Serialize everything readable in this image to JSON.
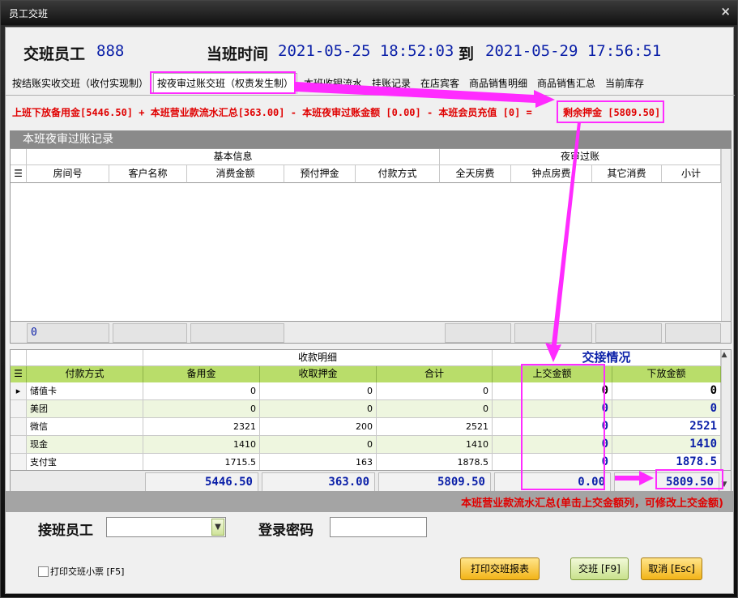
{
  "window": {
    "title": "员工交班",
    "close": "×"
  },
  "header": {
    "staff_label": "交班员工",
    "staff_value": "888",
    "shift_label": "当班时间",
    "start": "2021-05-25 18:52:03",
    "to": "到",
    "end": "2021-05-29 17:56:51"
  },
  "tabs": [
    {
      "label": "按结账实收交班（收付实现制）"
    },
    {
      "label": "按夜审过账交班（权责发生制）"
    },
    {
      "label": "本班收银流水"
    },
    {
      "label": "挂账记录"
    },
    {
      "label": "在店宾客"
    },
    {
      "label": "商品销售明细"
    },
    {
      "label": "商品销售汇总"
    },
    {
      "label": "当前库存"
    }
  ],
  "formula": {
    "text": "上班下放备用金[5446.50] + 本班营业款流水汇总[363.00] - 本班夜审过账金额 [0.00] - 本班会员充值 [0]  =",
    "remaining": "剩余押金 [5809.50]"
  },
  "night_audit": {
    "title": "本班夜审过账记录",
    "group_basic": "基本信息",
    "group_audit": "夜审过账",
    "columns": [
      "房间号",
      "客户名称",
      "消费金额",
      "预付押金",
      "付款方式",
      "全天房费",
      "钟点房费",
      "其它消费",
      "小计"
    ],
    "footer_count": "0"
  },
  "payments": {
    "group_detail": "收款明细",
    "group_handover": "交接情况",
    "columns": [
      "付款方式",
      "备用金",
      "收取押金",
      "合计",
      "上交金额",
      "下放金额"
    ],
    "rows": [
      {
        "method": "储值卡",
        "reserve": "0",
        "deposit": "0",
        "total": "0",
        "submit": "0",
        "release": "0"
      },
      {
        "method": "美团",
        "reserve": "0",
        "deposit": "0",
        "total": "0",
        "submit": "0",
        "release": "0"
      },
      {
        "method": "微信",
        "reserve": "2321",
        "deposit": "200",
        "total": "2521",
        "submit": "0",
        "release": "2521"
      },
      {
        "method": "现金",
        "reserve": "1410",
        "deposit": "0",
        "total": "1410",
        "submit": "0",
        "release": "1410"
      },
      {
        "method": "支付宝",
        "reserve": "1715.5",
        "deposit": "163",
        "total": "1878.5",
        "submit": "0",
        "release": "1878.5"
      }
    ],
    "totals": {
      "reserve": "5446.50",
      "deposit": "363.00",
      "total": "5809.50",
      "submit": "0.00",
      "release": "5809.50"
    }
  },
  "summary_note": "本班营业款流水汇总(单击上交金额列，可修改上交金额)",
  "bottom": {
    "receiver_label": "接班员工",
    "password_label": "登录密码",
    "print_ticket": "打印交班小票 [F5]",
    "print_report": "打印交班报表",
    "handover": "交班 [F9]",
    "cancel": "取消 [Esc]"
  },
  "colors": {
    "accent_blue": "#0a1fa8",
    "alert_red": "#e00000",
    "highlight_magenta": "#ff2bff",
    "row_green": "#b9dd6a"
  }
}
